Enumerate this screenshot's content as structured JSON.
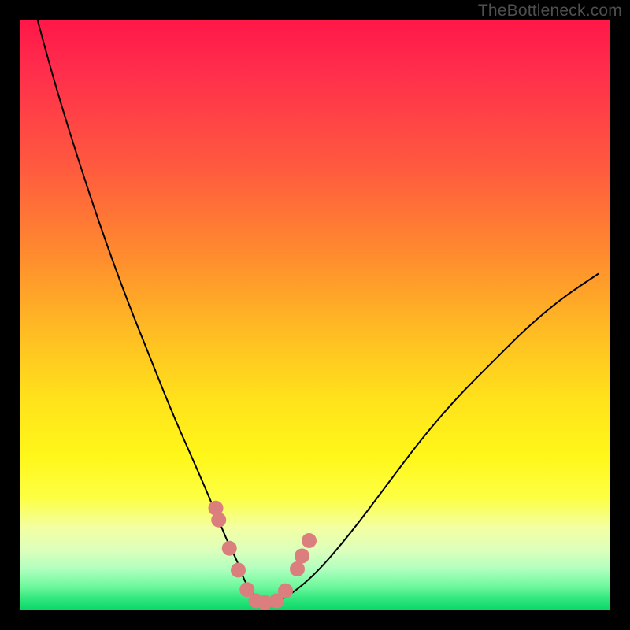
{
  "watermark": "TheBottleneck.com",
  "chart_data": {
    "type": "line",
    "title": "",
    "xlabel": "",
    "ylabel": "",
    "xlim": [
      0,
      100
    ],
    "ylim": [
      0,
      100
    ],
    "grid": false,
    "legend": false,
    "note": "Bottleneck curve: V-shaped black line; x is relative component balance, y is bottleneck severity (0 = none at valley, 100 = severe). Salmon dots mark near-optimal region around the valley.",
    "series": [
      {
        "name": "bottleneck-curve",
        "color": "#000000",
        "x": [
          3,
          6,
          10,
          14,
          18,
          22,
          26,
          30,
          33,
          35,
          37,
          38,
          40,
          42,
          45,
          50,
          56,
          62,
          68,
          74,
          80,
          86,
          92,
          98
        ],
        "y": [
          100,
          89,
          76,
          64,
          53,
          43,
          33,
          24,
          17,
          12,
          8,
          5,
          2,
          1,
          2,
          6,
          13,
          21,
          29,
          36,
          42,
          48,
          53,
          57
        ]
      },
      {
        "name": "optimal-markers",
        "color": "#db7f7e",
        "type": "scatter",
        "x": [
          33.2,
          33.7,
          35.5,
          37.0,
          38.5,
          40.0,
          41.5,
          43.5,
          45.0,
          47.0,
          47.8,
          49.0
        ],
        "y": [
          17.3,
          15.3,
          10.5,
          6.8,
          3.5,
          1.6,
          1.3,
          1.6,
          3.3,
          7.0,
          9.2,
          11.8
        ]
      }
    ]
  }
}
